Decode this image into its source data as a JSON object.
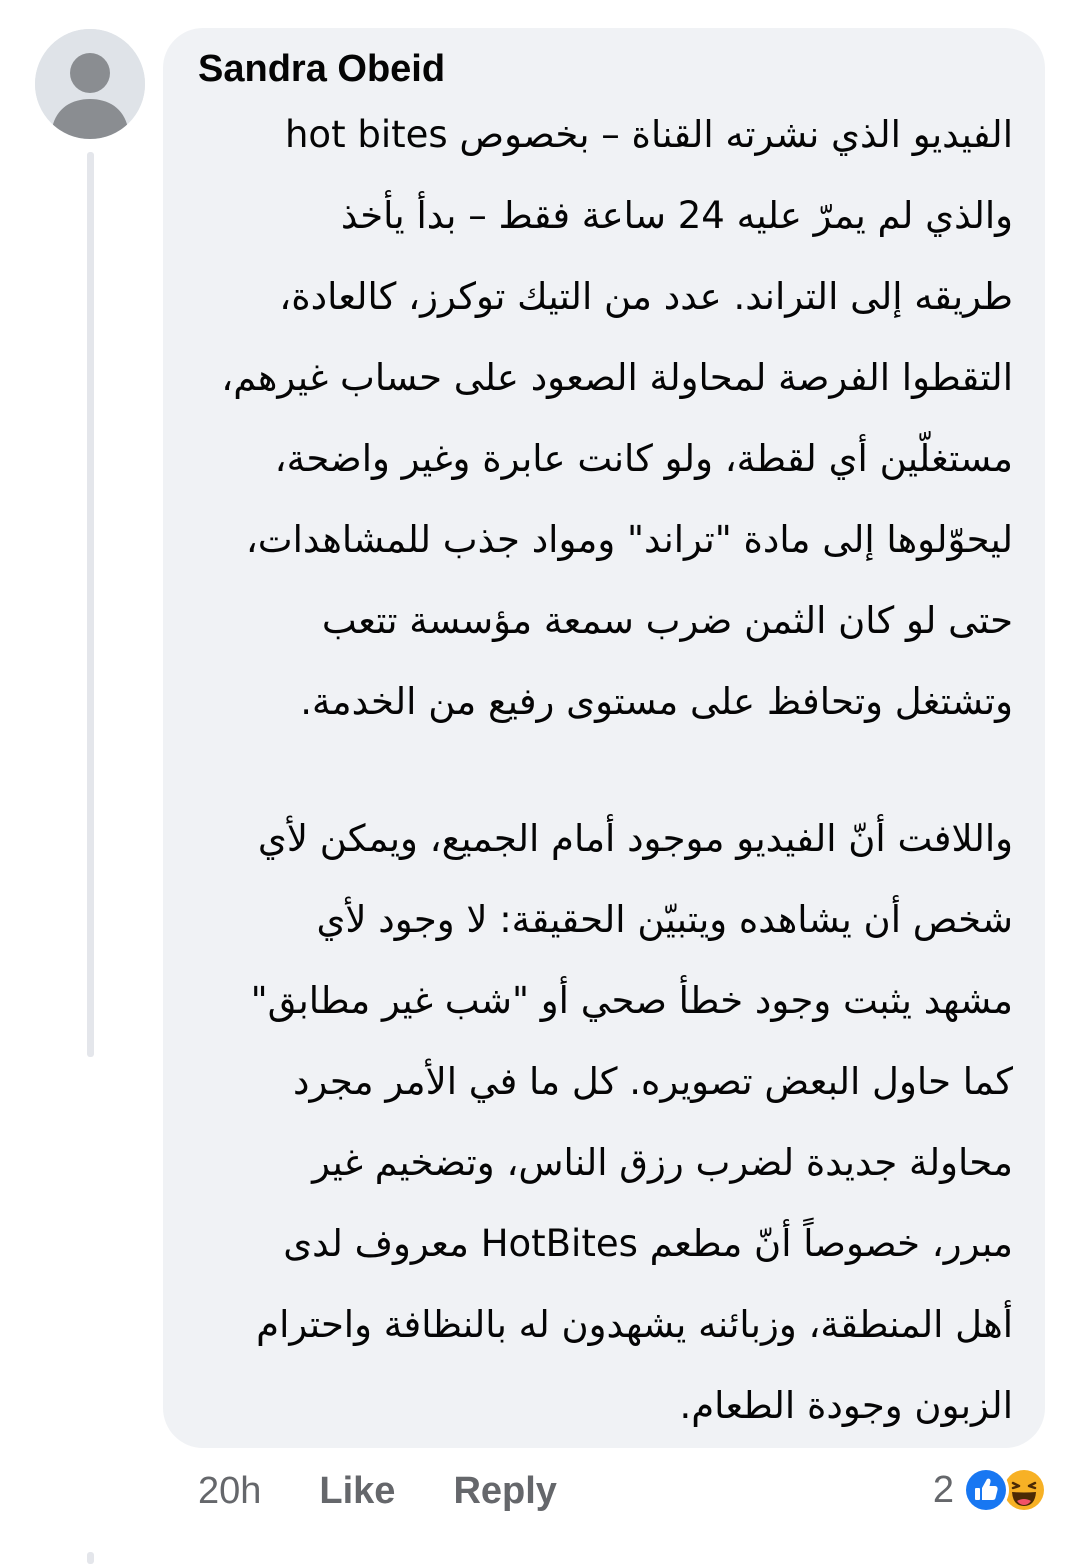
{
  "comment": {
    "author": "Sandra Obeid",
    "avatar_icon": "default-profile-icon",
    "paragraphs": [
      [
        "الفيديو الذي نشرته القناة – بخصوص hot bites",
        "والذي لم يمرّ عليه 24 ساعة فقط – بدأ يأخذ",
        "طريقه إلى التراند. عدد من التيك توكرز، كالعادة،",
        "التقطوا الفرصة لمحاولة الصعود على حساب غيرهم،",
        "مستغلّين أي لقطة، ولو كانت عابرة وغير واضحة،",
        "ليحوّلوها إلى مادة \"تراند\" ومواد جذب للمشاهدات،",
        "حتى لو كان الثمن ضرب سمعة مؤسسة تتعب",
        "وتشتغل وتحافظ على مستوى رفيع من الخدمة."
      ],
      [
        "واللافت أنّ الفيديو موجود أمام الجميع، ويمكن لأي",
        "شخص أن يشاهده ويتبيّن الحقيقة: لا وجود لأي",
        "مشهد يثبت وجود خطأ صحي أو \"شب غير مطابق\"",
        "كما حاول البعض تصويره. كل ما في الأمر مجرد",
        "محاولة جديدة لضرب رزق الناس، وتضخيم غير",
        "مبرر، خصوصاً أنّ مطعم HotBites معروف لدى",
        "أهل المنطقة، وزبائنه يشهدون له بالنظافة واحترام",
        "الزبون وجودة الطعام."
      ]
    ]
  },
  "actions": {
    "time": "20h",
    "like_label": "Like",
    "reply_label": "Reply"
  },
  "reactions": {
    "count": "2",
    "types": [
      "like-reaction-icon",
      "haha-reaction-icon"
    ],
    "like_color": "#1877f2",
    "haha_color": "#f7b125"
  },
  "colors": {
    "bubble": "#f0f2f5",
    "text": "#050505",
    "secondary_text": "#65676b",
    "thread_line": "#e4e6eb"
  }
}
